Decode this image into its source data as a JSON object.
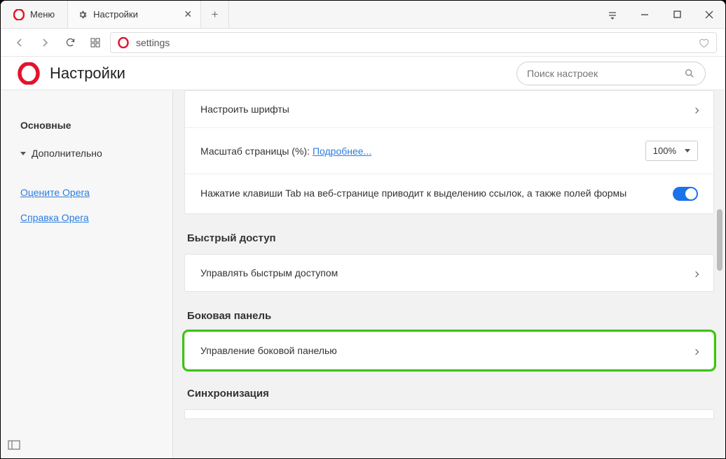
{
  "titlebar": {
    "menu_label": "Меню",
    "tab_label": "Настройки"
  },
  "address_bar": {
    "url": "settings"
  },
  "header": {
    "title": "Настройки",
    "search_placeholder": "Поиск настроек"
  },
  "sidebar": {
    "items": [
      {
        "label": "Основные"
      },
      {
        "label": "Дополнительно"
      }
    ],
    "links": [
      {
        "label": "Оцените Opera"
      },
      {
        "label": "Справка Opera"
      }
    ]
  },
  "sections": {
    "fonts_row": "Настроить шрифты",
    "zoom_label": "Масштаб страницы (%):",
    "zoom_more": "Подробнее...",
    "zoom_value": "100%",
    "tab_key_text": "Нажатие клавиши Tab на веб-странице приводит к выделению ссылок, а также полей формы",
    "speed_dial_title": "Быстрый доступ",
    "speed_dial_row": "Управлять быстрым доступом",
    "sidebar_title": "Боковая панель",
    "sidebar_row": "Управление боковой панелью",
    "sync_title": "Синхронизация"
  }
}
